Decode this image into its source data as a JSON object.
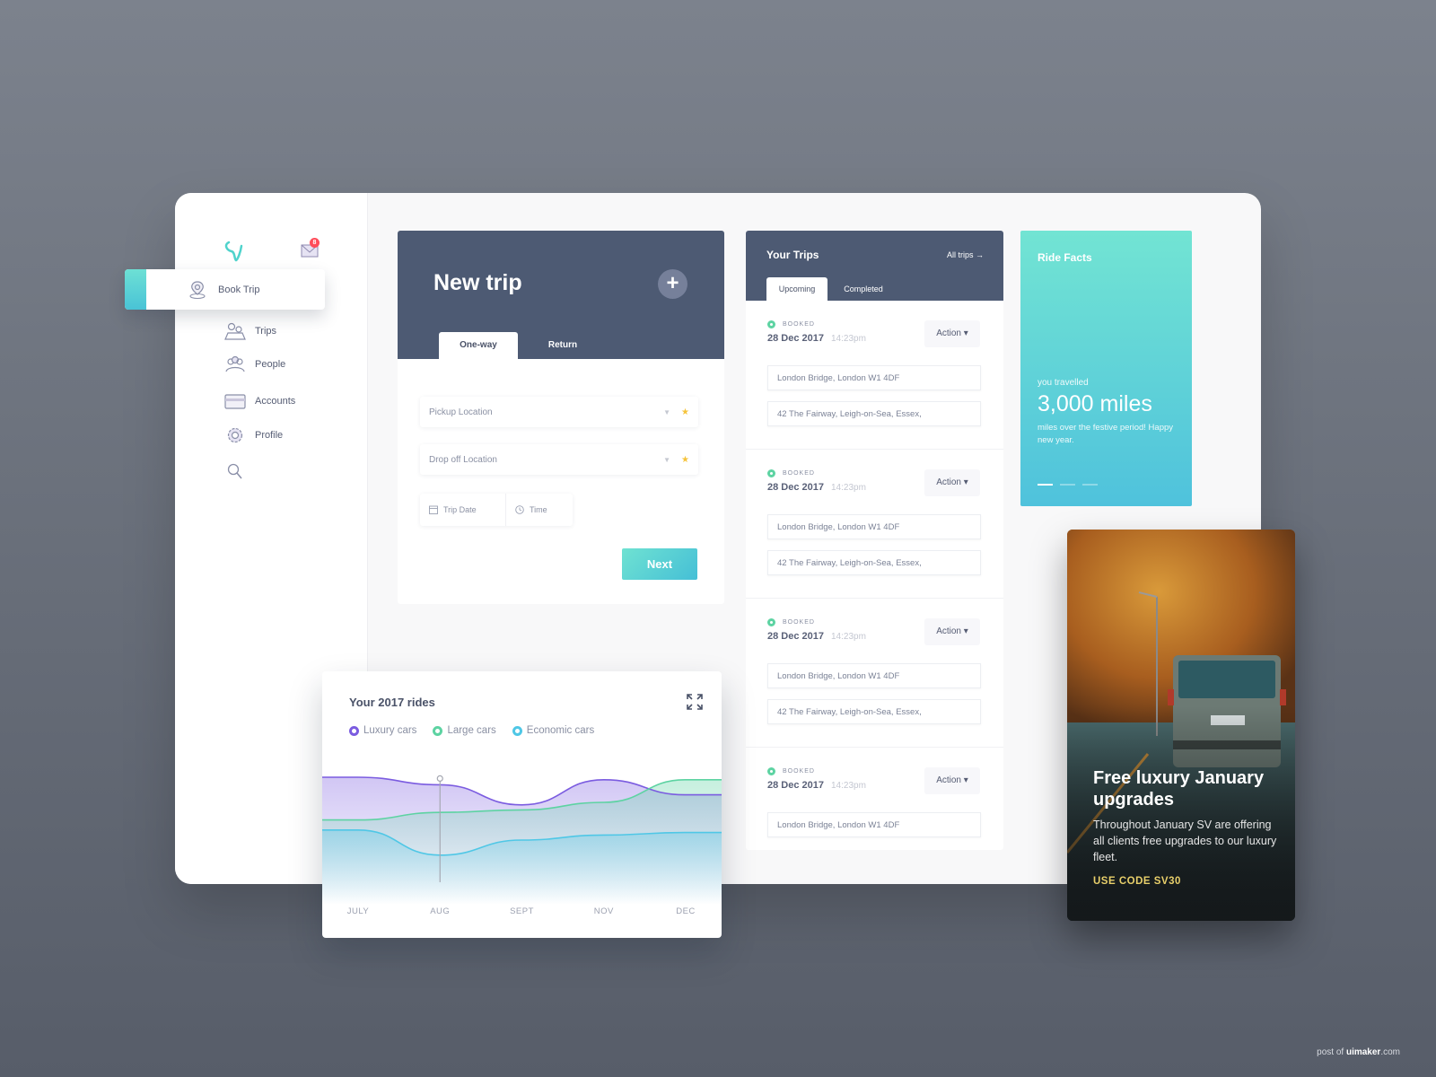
{
  "sidebar": {
    "mail_badge": "8",
    "active_item": "Book Trip",
    "items": [
      {
        "label": "Trips",
        "icon": "map-pins-icon"
      },
      {
        "label": "People",
        "icon": "people-icon"
      },
      {
        "label": "Accounts",
        "icon": "credit-card-icon"
      },
      {
        "label": "Profile",
        "icon": "gear-icon"
      }
    ]
  },
  "new_trip": {
    "title": "New trip",
    "add_label": "+",
    "tabs": [
      "One-way",
      "Return"
    ],
    "active_tab": "One-way",
    "pickup_placeholder": "Pickup Location",
    "dropoff_placeholder": "Drop off Location",
    "date_placeholder": "Trip Date",
    "time_placeholder": "Time",
    "next_label": "Next"
  },
  "your_trips": {
    "title": "Your Trips",
    "all_trips_label": "All trips →",
    "tabs": [
      "Upcoming",
      "Completed"
    ],
    "active_tab": "Upcoming",
    "trips": [
      {
        "status": "BOOKED",
        "date": "28 Dec 2017",
        "time": "14:23pm",
        "action": "Action ▾",
        "from": "London Bridge, London W1 4DF",
        "to": "42 The Fairway, Leigh-on-Sea, Essex,"
      },
      {
        "status": "BOOKED",
        "date": "28 Dec 2017",
        "time": "14:23pm",
        "action": "Action ▾",
        "from": "London Bridge, London W1 4DF",
        "to": "42 The Fairway, Leigh-on-Sea, Essex,"
      },
      {
        "status": "BOOKED",
        "date": "28 Dec 2017",
        "time": "14:23pm",
        "action": "Action ▾",
        "from": "London Bridge, London W1 4DF",
        "to": "42 The Fairway, Leigh-on-Sea, Essex,"
      },
      {
        "status": "BOOKED",
        "date": "28 Dec 2017",
        "time": "14:23pm",
        "action": "Action ▾",
        "from": "London Bridge, London W1 4DF",
        "to": ""
      }
    ]
  },
  "ride_facts": {
    "title": "Ride Facts",
    "subtitle": "you travelled",
    "value": "3,000 miles",
    "description": "miles over the festive period! Happy new year.",
    "slides": 3,
    "active_slide": 1
  },
  "promo": {
    "title": "Free luxury January upgrades",
    "description": "Throughout January SV are offering all clients free upgrades to our luxury fleet.",
    "code": "USE CODE SV30"
  },
  "chart_data": {
    "type": "area",
    "title": "Your 2017 rides",
    "x": [
      "JULY",
      "AUG",
      "SEPT",
      "NOV",
      "DEC"
    ],
    "series": [
      {
        "name": "Luxury cars",
        "color": "#7b5ce0",
        "values": [
          80,
          74,
          58,
          78,
          66
        ]
      },
      {
        "name": "Large cars",
        "color": "#5dd3a2",
        "values": [
          46,
          52,
          54,
          60,
          78
        ]
      },
      {
        "name": "Economic cars",
        "color": "#4fc7e6",
        "values": [
          38,
          18,
          30,
          34,
          36
        ]
      }
    ],
    "ylim": [
      0,
      100
    ],
    "highlight_x": "AUG",
    "grid": false,
    "legend": "top-left"
  },
  "watermark": {
    "prefix": "post of ",
    "brand": "uimaker",
    "suffix": ".com"
  }
}
